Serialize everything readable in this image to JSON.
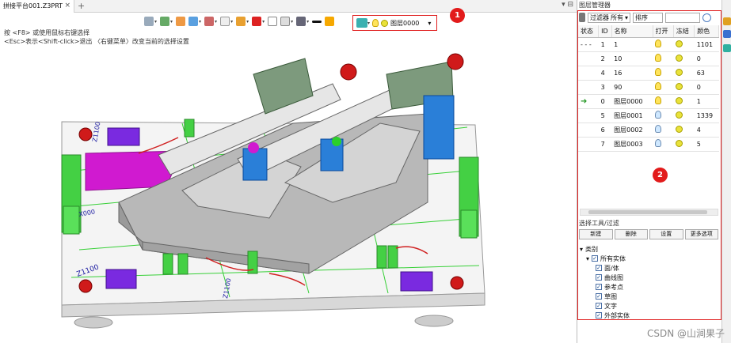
{
  "tab": {
    "title": "拼接平台001.Z3PRT",
    "close": "×",
    "add": "+"
  },
  "window_controls": "▾  ⊟",
  "hints": [
    "按 <F8> 或使用鼠标右键选择",
    "<Esc>表示<Shift-click>退出  〈右键菜单〉改变当前的选择设置"
  ],
  "layer": {
    "label": "图层0000",
    "caret": "▾"
  },
  "badges": [
    "1",
    "2"
  ],
  "panel": {
    "title": "图层管理器",
    "filter_label": "过滤器",
    "filter_value": "所有",
    "sort_value": "排序",
    "columns": [
      "状态",
      "ID",
      "名称",
      "打开",
      "冻结",
      "颜色"
    ],
    "rows": [
      {
        "state": "- - -",
        "id": "1",
        "name": "1",
        "color": "1101"
      },
      {
        "state": "",
        "id": "2",
        "name": "10",
        "color": "0"
      },
      {
        "state": "",
        "id": "4",
        "name": "16",
        "color": "63"
      },
      {
        "state": "",
        "id": "3",
        "name": "90",
        "color": "0"
      },
      {
        "state": "➜",
        "id": "0",
        "name": "图层0000",
        "color": "1"
      },
      {
        "state": "",
        "id": "5",
        "name": "图层0001",
        "color": "1339"
      },
      {
        "state": "",
        "id": "6",
        "name": "图层0002",
        "color": "4"
      },
      {
        "state": "",
        "id": "7",
        "name": "图层0003",
        "color": "5"
      }
    ],
    "section_title": "选择工具/过滤",
    "buttons": [
      "新建",
      "删除",
      "设置",
      "更多选项"
    ],
    "tree_root": "类别",
    "tree_parent": "所有实体",
    "tree_items": [
      "面/体",
      "曲线图",
      "参考点",
      "草图",
      "文字",
      "外部实体"
    ]
  },
  "model_labels": [
    "Z1100",
    "Z1100",
    "X000",
    "Z1100"
  ],
  "watermark": "CSDN @山涧果子",
  "colors": {
    "accent_red": "#e21b1b",
    "model_gray": "#b8b8b8",
    "fixture_green": "#44d044",
    "block_blue": "#2a7fd8",
    "plate_purple": "#7a2ae0",
    "magenta": "#d01ad0"
  }
}
